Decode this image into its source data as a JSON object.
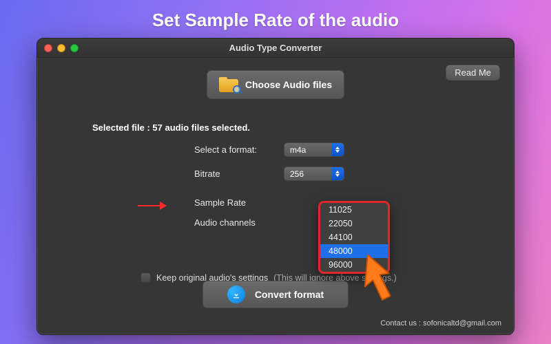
{
  "tagline": "Set Sample Rate of the audio",
  "window_title": "Audio Type Converter",
  "readme_label": "Read Me",
  "choose_label": "Choose Audio files",
  "selected_status": "Selected file : 57 audio files selected.",
  "labels": {
    "format": "Select a format:",
    "bitrate": "Bitrate",
    "sample_rate": "Sample Rate",
    "channels": "Audio channels"
  },
  "format_value": "m4a",
  "bitrate_value": "256",
  "sample_rate_options": [
    "11025",
    "22050",
    "44100",
    "48000",
    "96000"
  ],
  "sample_rate_selected": "48000",
  "keep_original_label": "Keep original audio's settings",
  "keep_original_note": "(This will ignore above settings.)",
  "convert_label": "Convert format",
  "contact_text": "Contact us : sofonicaltd@gmail.com"
}
